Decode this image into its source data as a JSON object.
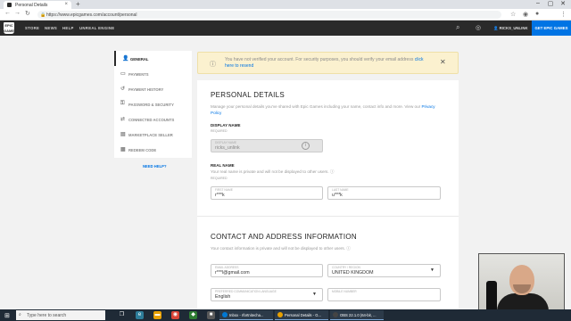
{
  "browser": {
    "tab_title": "Personal Details",
    "url": "https://www.epicgames.com/account/personal",
    "new_tab": "+",
    "tab_close": "×",
    "window_min": "–",
    "window_max": "▢",
    "window_close": "✕",
    "back": "←",
    "forward": "→",
    "reload": "↻",
    "lock": "🔒"
  },
  "site_nav": {
    "logo": "EPIC GAMES",
    "links": [
      "STORE",
      "NEWS",
      "HELP",
      "UNREAL ENGINE"
    ],
    "user_name": "RICKS_UNLINK",
    "get_button": "GET EPIC GAMES"
  },
  "sidebar": {
    "items": [
      {
        "label": "GENERAL",
        "icon": "person-icon",
        "glyph": "👤",
        "active": true
      },
      {
        "label": "PAYMENTS",
        "icon": "card-icon",
        "glyph": "▭",
        "active": false
      },
      {
        "label": "PAYMENT HISTORY",
        "icon": "history-icon",
        "glyph": "↺",
        "active": false
      },
      {
        "label": "PASSWORD & SECURITY",
        "icon": "key-icon",
        "glyph": "⚿",
        "active": false
      },
      {
        "label": "CONNECTED ACCOUNTS",
        "icon": "link-icon",
        "glyph": "⇄",
        "active": false
      },
      {
        "label": "MARKETPLACE SELLER",
        "icon": "store-icon",
        "glyph": "▤",
        "active": false
      },
      {
        "label": "REDEEM CODE",
        "icon": "gift-icon",
        "glyph": "▦",
        "active": false
      }
    ],
    "need_help": "NEED HELP?"
  },
  "banner": {
    "text": "You have not verified your account. For security purposes, you should verify your email address",
    "link": "click here to resend",
    "warn_glyph": "ⓘ",
    "close_glyph": "✕"
  },
  "personal": {
    "title": "PERSONAL DETAILS",
    "description": "Manage your personal details you've shared with Epic Games including your name, contact info and more. View our",
    "privacy_link": "Privacy Policy",
    "display_name_label": "DISPLAY NAME",
    "required": "REQUIRED",
    "display_name_field_label": "DISPLAY NAME",
    "display_name_value": "ricks_unlink",
    "info_glyph": "i",
    "real_name_label": "REAL NAME",
    "real_name_note": "Your real name is private and will not be displayed to other users.",
    "first_name_field_label": "FIRST NAME",
    "first_name_value": "r***k",
    "last_name_field_label": "LAST NAME",
    "last_name_value": "u***k"
  },
  "contact": {
    "title": "CONTACT AND ADDRESS INFORMATION",
    "note": "Your contact information is private and will not be displayed to other users.",
    "email_field_label": "EMAIL ADDRESS",
    "email_value": "r***l@gmail.com",
    "country_field_label": "COUNTRY / REGION",
    "country_value": "UNITED KINGDOM",
    "language_field_label": "PREFERRED COMMUNICATION LANGUAGE",
    "language_value": "English",
    "mobile_field_label": "MOBILE NUMBER",
    "mobile_value": ""
  },
  "taskbar": {
    "start": "⊞",
    "search_placeholder": "Type here to search",
    "apps": [
      {
        "label": "Inbox - rfortnitecha...",
        "color": "#0078d4"
      },
      {
        "label": "Personal Details - G...",
        "color": "#e8a000"
      },
      {
        "label": "OBS 22.1.0 (64-bit, ...",
        "color": "#444444"
      }
    ]
  }
}
